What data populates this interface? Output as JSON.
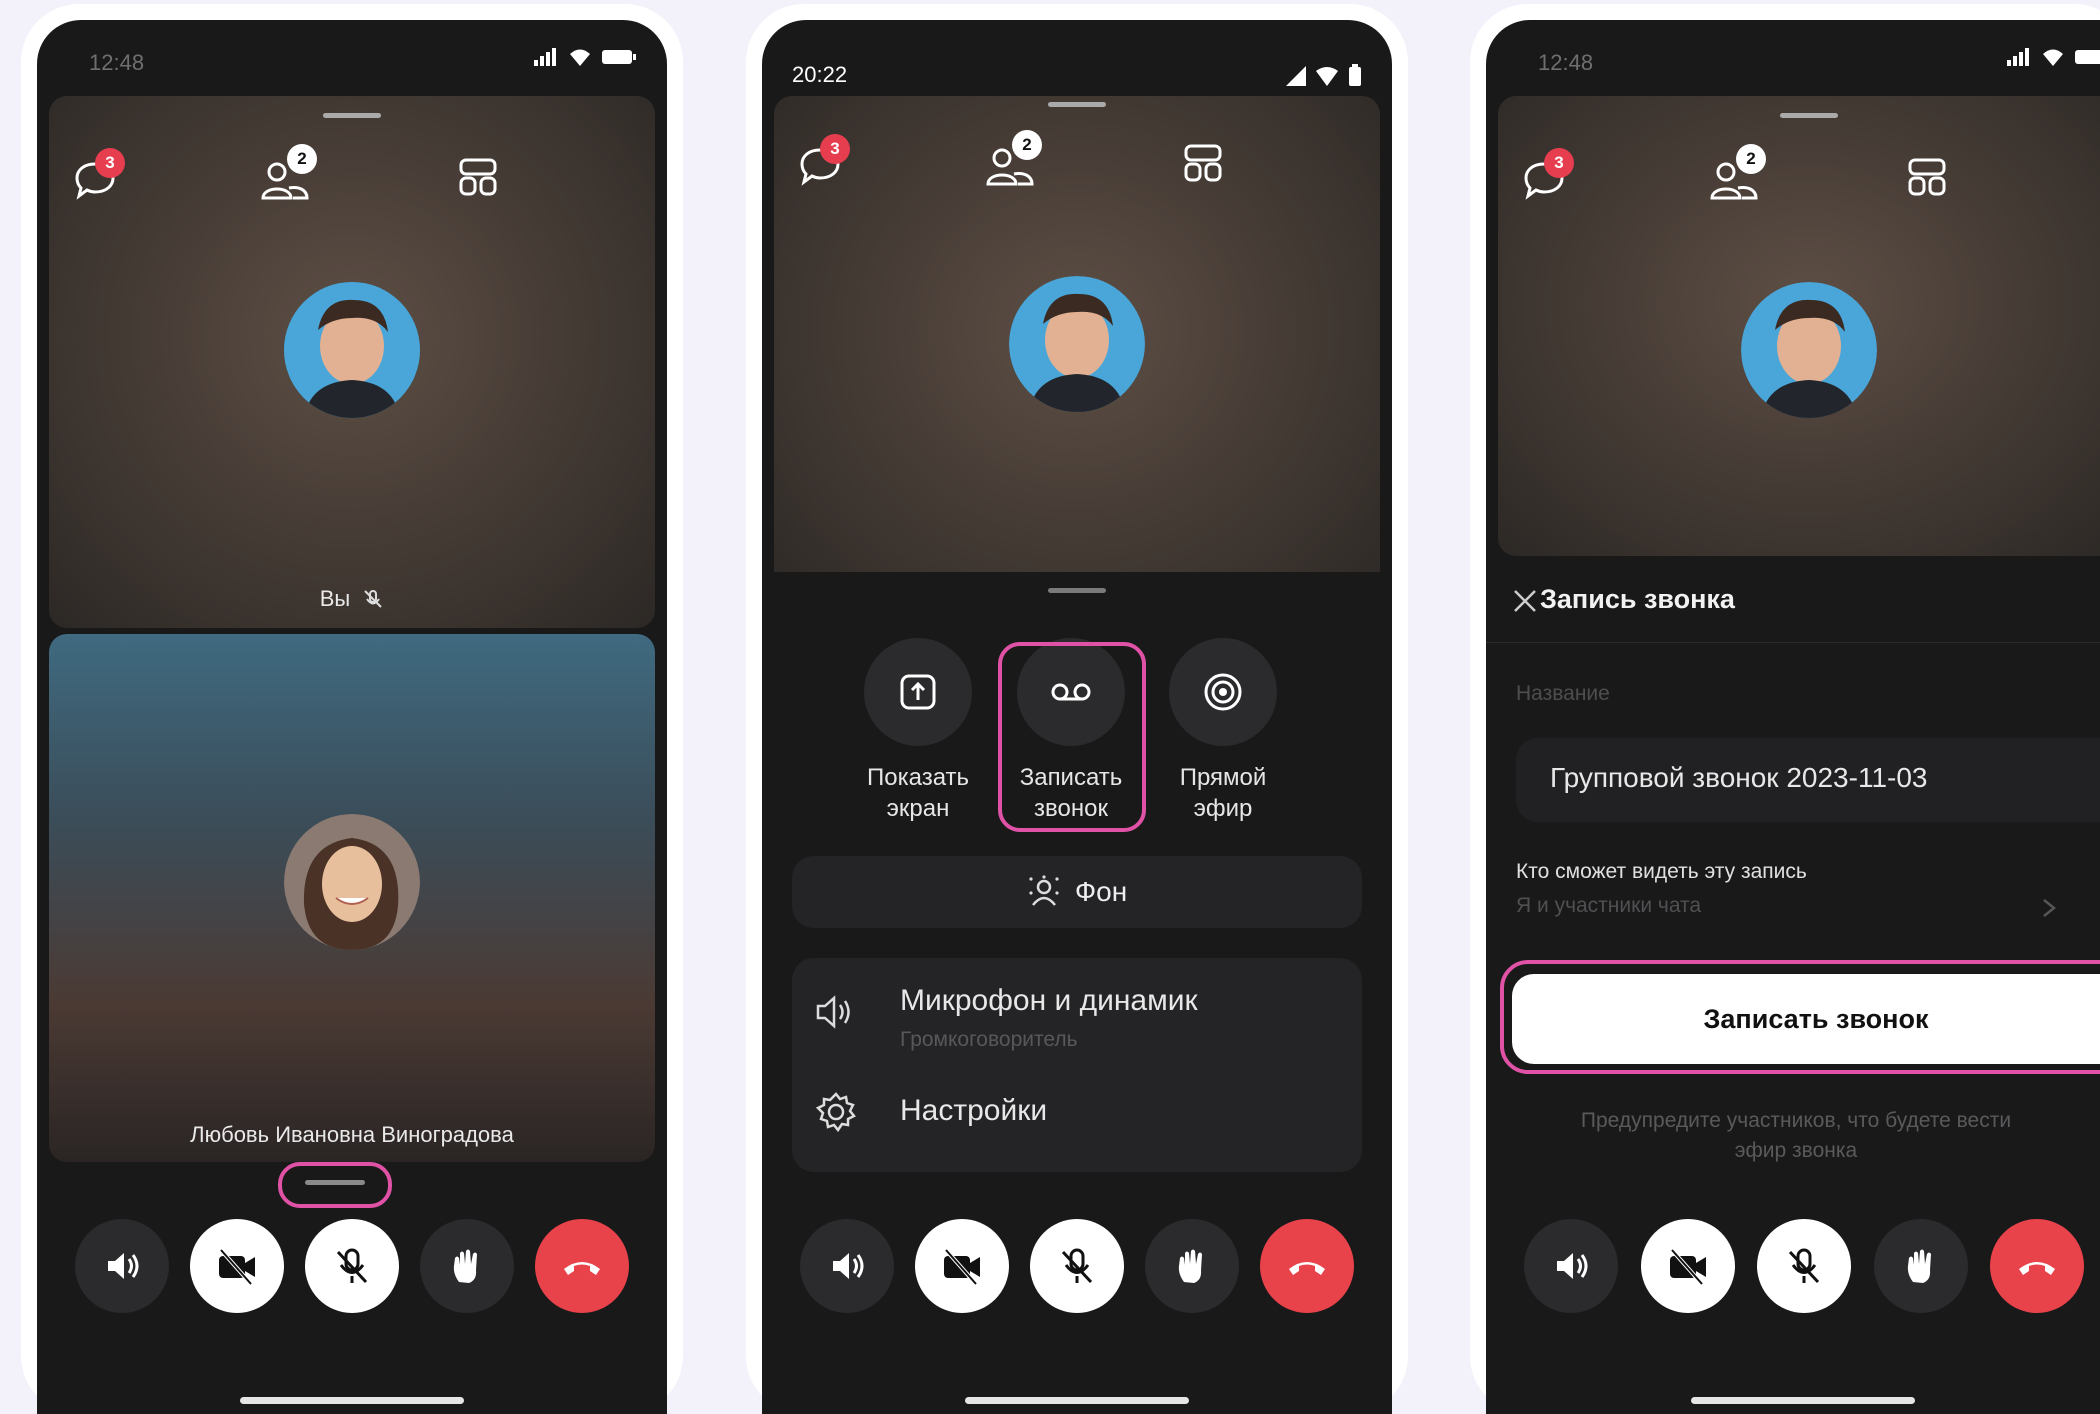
{
  "colors": {
    "accent": "#e052a6",
    "end_call": "#e8424a",
    "badge": "#e63e4f",
    "screen_bg": "#19191a"
  },
  "panel1": {
    "status": {
      "time": "12:48"
    },
    "badges": {
      "chat": "3",
      "participants": "2"
    },
    "self_label": "Вы",
    "remote_name": "Любовь Ивановна Виноградова",
    "icons": [
      "chat-icon",
      "participants-icon",
      "layout-grid-icon",
      "speaker-icon",
      "camera-off-icon",
      "mic-off-icon",
      "raise-hand-icon",
      "end-call-icon"
    ]
  },
  "panel2": {
    "status": {
      "time": "20:22"
    },
    "badges": {
      "chat": "3",
      "participants": "2"
    },
    "options": [
      {
        "label1": "Показать",
        "label2": "экран",
        "icon": "share-screen-icon"
      },
      {
        "label1": "Записать",
        "label2": "звонок",
        "icon": "record-icon"
      },
      {
        "label1": "Прямой",
        "label2": "эфир",
        "icon": "live-icon"
      }
    ],
    "background_label": "Фон",
    "mic_title": "Микрофон и динамик",
    "mic_subtitle": "Громкоговоритель",
    "settings_label": "Настройки"
  },
  "panel3": {
    "status": {
      "time": "12:48"
    },
    "badges": {
      "chat": "3",
      "participants": "2"
    },
    "title": "Запись звонка",
    "name_label": "Название",
    "name_value": "Групповой звонок 2023-11-03",
    "visibility_label": "Кто сможет видеть эту запись",
    "visibility_value": "Я и участники чата",
    "record_button": "Записать звонок",
    "warning_line1": "Предупредите участников, что будете вести",
    "warning_line2": "эфир звонка"
  }
}
